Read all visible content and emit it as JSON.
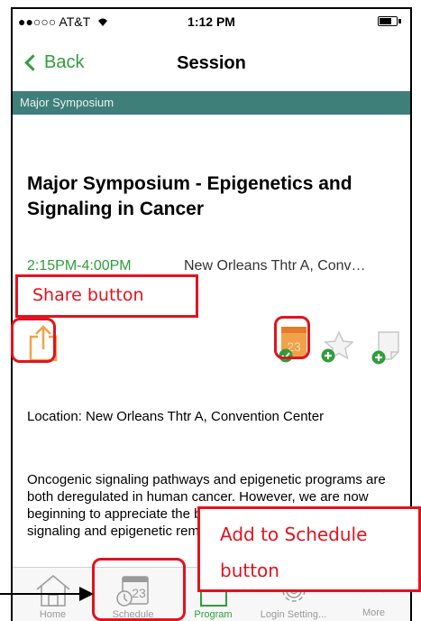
{
  "status_bar": {
    "carrier": "●●○○○ AT&T",
    "time": "1:12 PM",
    "battery_level": 0.7
  },
  "nav": {
    "back_label": "Back",
    "title": "Session"
  },
  "category": "Major Symposium",
  "session": {
    "title": "Major Symposium - Epigenetics and Signaling in Cancer",
    "time": "2:15PM-4:00PM",
    "place": "New Orleans Thtr A, Conv…",
    "location": "Location: New Orleans Thtr A, Convention Center",
    "abstract": "Oncogenic signaling pathways and epigenetic programs are both deregulated in human cancer.  However, we are now beginning to appreciate the bidirectional convergence of cell signaling and epigenetic remodeling. This"
  },
  "icons": {
    "share": "share-icon",
    "add_schedule": "calendar-add-icon",
    "add_favorite": "star-add-icon",
    "add_note": "note-add-icon"
  },
  "calendar_icon_number": "23",
  "tabs": [
    {
      "label": "Home",
      "icon": "home-icon"
    },
    {
      "label": "Schedule",
      "icon": "schedule-icon",
      "number": "23"
    },
    {
      "label": "Program",
      "icon": "program-icon"
    },
    {
      "label": "Login Setting...",
      "icon": "gear-icon"
    },
    {
      "label": "More",
      "icon": "more-icon",
      "glyph": "○ ○ ○"
    }
  ],
  "annotations": {
    "share": "Share button",
    "schedule_line1": "Add to Schedule",
    "schedule_line2": "button"
  },
  "colors": {
    "accent": "#2e9e3a",
    "category_bar": "#3f7f7a",
    "annotation": "#e0141e",
    "calendar": "#f0a24a"
  }
}
